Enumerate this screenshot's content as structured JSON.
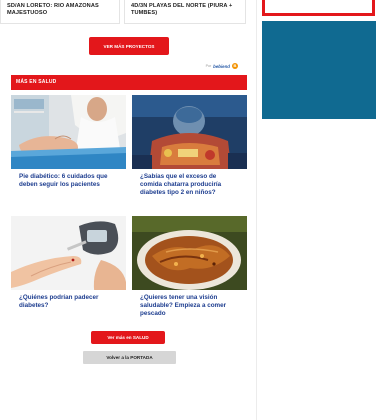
{
  "promos": [
    {
      "title": "SD/AN LORETO: RIO AMAZONAS MAJESTUOSO"
    },
    {
      "title": "4D/3N PLAYAS DEL NORTE (PIURA + TUMBES)"
    }
  ],
  "more_projects_label": "VER MÁS PROYECTOS",
  "sponsor": {
    "prefix": "Por",
    "brand": "bebiend",
    "badge": "B"
  },
  "section": {
    "title": "MÁS EN SALUD"
  },
  "articles": [
    {
      "title": "Pie diabético: 6 cuidados que deben seguir los pacientes"
    },
    {
      "title": "¿Sabías que el exceso de comida chatarra produciría diabetes tipo 2 en niños?"
    },
    {
      "title": "¿Quiénes podrían padecer diabetes?"
    },
    {
      "title": "¿Quieres tener una visión saludable? Empieza a comer pescado"
    }
  ],
  "buttons": {
    "more_salud": "Ver más en SALUD",
    "back_home": "Volver a la PORTADA"
  },
  "colors": {
    "accent": "#e3171b",
    "link": "#1d3d8f",
    "ad_block": "#106a91",
    "button_grey": "#d6d6d6"
  }
}
